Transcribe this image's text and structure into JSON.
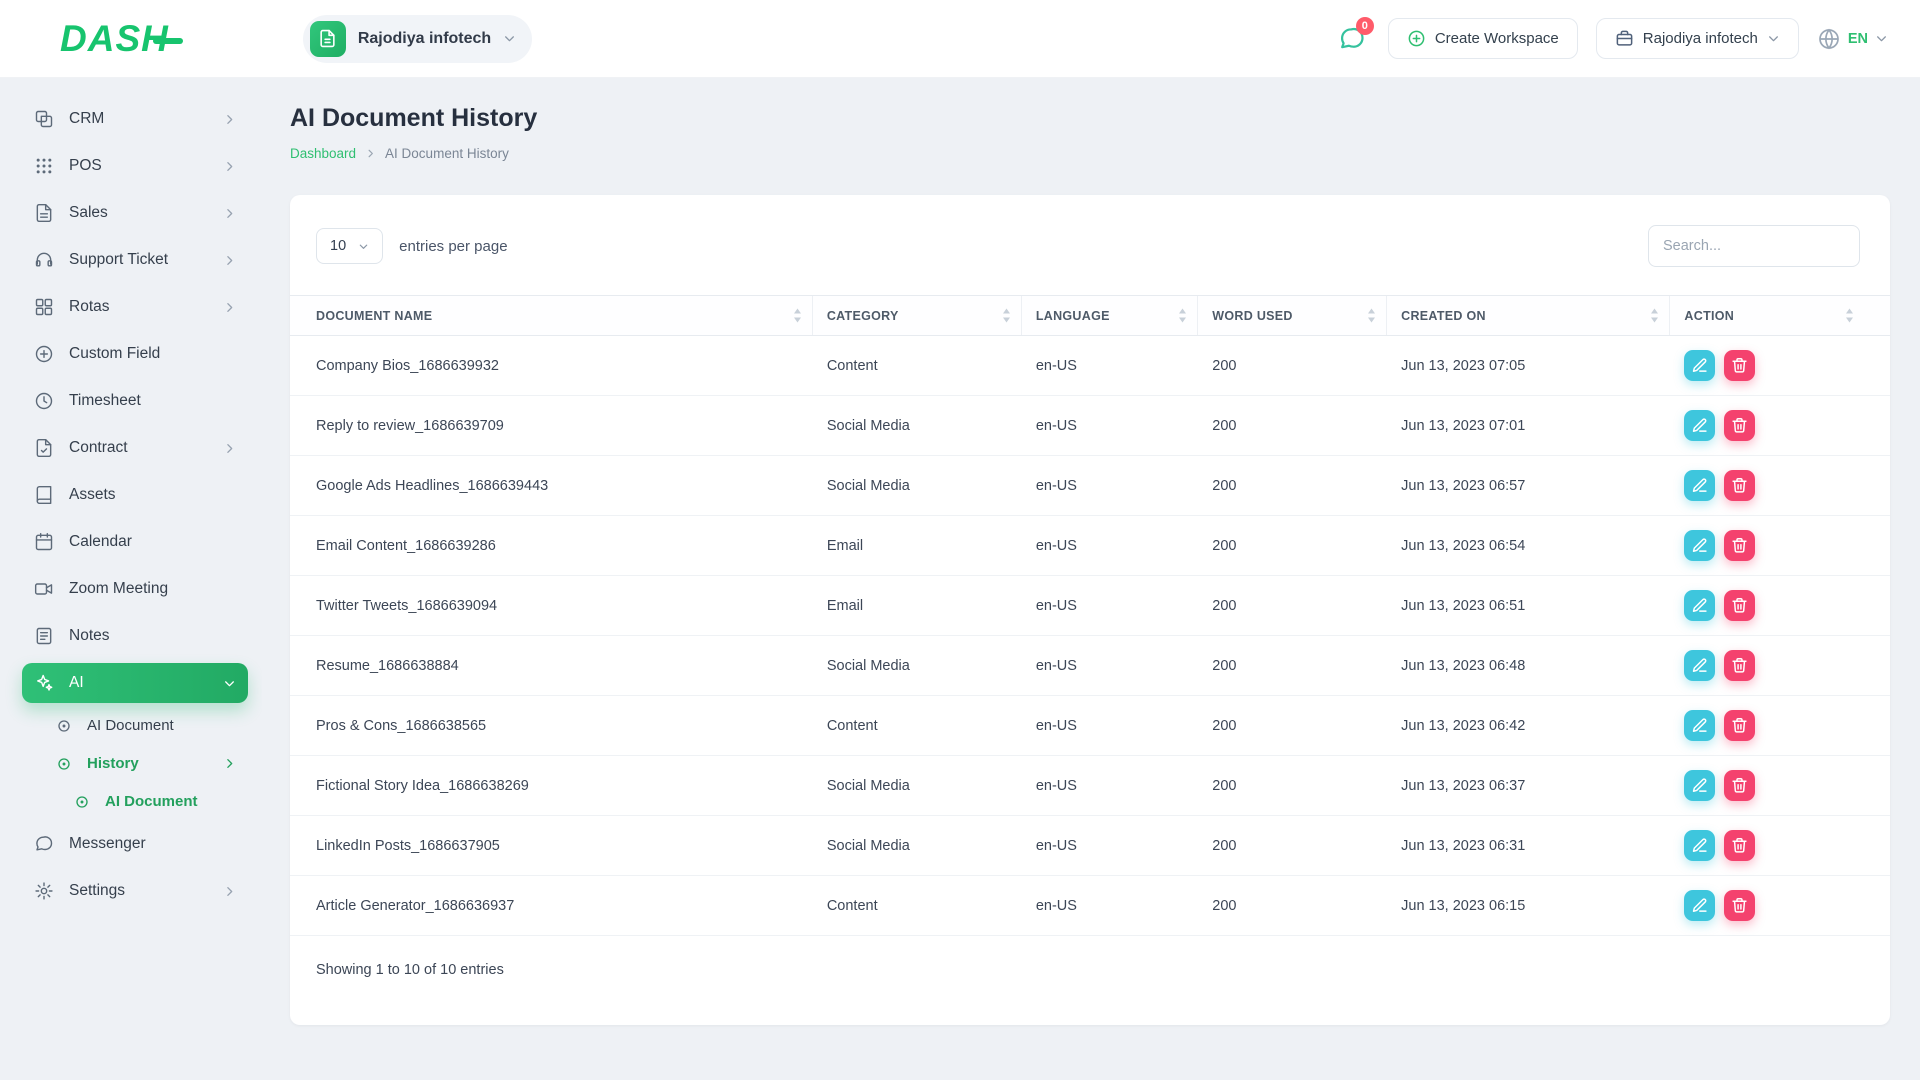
{
  "brand": {
    "logo_text": "DASH"
  },
  "header": {
    "workspace_label": "Rajodiya infotech",
    "messages_badge": "0",
    "create_workspace_label": "Create Workspace",
    "account_label": "Rajodiya infotech",
    "language_label": "EN"
  },
  "sidebar": {
    "items": [
      {
        "id": "crm",
        "label": "CRM",
        "icon": "crm",
        "chevron": "right"
      },
      {
        "id": "pos",
        "label": "POS",
        "icon": "pos",
        "chevron": "right"
      },
      {
        "id": "sales",
        "label": "Sales",
        "icon": "sales",
        "chevron": "right"
      },
      {
        "id": "support-ticket",
        "label": "Support Ticket",
        "icon": "support",
        "chevron": "right"
      },
      {
        "id": "rotas",
        "label": "Rotas",
        "icon": "rotas",
        "chevron": "right"
      },
      {
        "id": "custom-field",
        "label": "Custom Field",
        "icon": "plus-circle"
      },
      {
        "id": "timesheet",
        "label": "Timesheet",
        "icon": "clock"
      },
      {
        "id": "contract",
        "label": "Contract",
        "icon": "contract",
        "chevron": "right"
      },
      {
        "id": "assets",
        "label": "Assets",
        "icon": "book"
      },
      {
        "id": "calendar",
        "label": "Calendar",
        "icon": "calendar"
      },
      {
        "id": "zoom-meeting",
        "label": "Zoom Meeting",
        "icon": "video"
      },
      {
        "id": "notes",
        "label": "Notes",
        "icon": "notes"
      },
      {
        "id": "ai",
        "label": "AI",
        "icon": "ai",
        "chevron": "down",
        "active": true
      },
      {
        "id": "ai-document",
        "label": "AI Document",
        "icon": "bullet",
        "level": 1
      },
      {
        "id": "history",
        "label": "History",
        "icon": "bullet",
        "level": 1,
        "chevron": "right",
        "highlight": true
      },
      {
        "id": "history-ai-document",
        "label": "AI Document",
        "icon": "bullet",
        "level": 2,
        "highlight": true
      },
      {
        "id": "messenger",
        "label": "Messenger",
        "icon": "messenger"
      },
      {
        "id": "settings",
        "label": "Settings",
        "icon": "settings",
        "chevron": "right"
      }
    ]
  },
  "page": {
    "title": "AI Document History",
    "breadcrumb": [
      "Dashboard",
      "AI Document History"
    ]
  },
  "controls": {
    "page_size": "10",
    "entries_label": "entries per page",
    "search_placeholder": "Search..."
  },
  "table": {
    "columns": [
      {
        "key": "name",
        "label": "DOCUMENT NAME"
      },
      {
        "key": "category",
        "label": "CATEGORY"
      },
      {
        "key": "language",
        "label": "LANGUAGE"
      },
      {
        "key": "words",
        "label": "WORD USED"
      },
      {
        "key": "created",
        "label": "CREATED ON"
      },
      {
        "key": "action",
        "label": "ACTION"
      }
    ],
    "rows": [
      {
        "name": "Company Bios_1686639932",
        "category": "Content",
        "language": "en-US",
        "words": "200",
        "created": "Jun 13, 2023 07:05"
      },
      {
        "name": "Reply to review_1686639709",
        "category": "Social Media",
        "language": "en-US",
        "words": "200",
        "created": "Jun 13, 2023 07:01"
      },
      {
        "name": "Google Ads Headlines_1686639443",
        "category": "Social Media",
        "language": "en-US",
        "words": "200",
        "created": "Jun 13, 2023 06:57"
      },
      {
        "name": "Email Content_1686639286",
        "category": "Email",
        "language": "en-US",
        "words": "200",
        "created": "Jun 13, 2023 06:54"
      },
      {
        "name": "Twitter Tweets_1686639094",
        "category": "Email",
        "language": "en-US",
        "words": "200",
        "created": "Jun 13, 2023 06:51"
      },
      {
        "name": "Resume_1686638884",
        "category": "Social Media",
        "language": "en-US",
        "words": "200",
        "created": "Jun 13, 2023 06:48"
      },
      {
        "name": "Pros & Cons_1686638565",
        "category": "Content",
        "language": "en-US",
        "words": "200",
        "created": "Jun 13, 2023 06:42"
      },
      {
        "name": "Fictional Story Idea_1686638269",
        "category": "Social Media",
        "language": "en-US",
        "words": "200",
        "created": "Jun 13, 2023 06:37"
      },
      {
        "name": "LinkedIn Posts_1686637905",
        "category": "Social Media",
        "language": "en-US",
        "words": "200",
        "created": "Jun 13, 2023 06:31"
      },
      {
        "name": "Article Generator_1686636937",
        "category": "Content",
        "language": "en-US",
        "words": "200",
        "created": "Jun 13, 2023 06:15"
      }
    ],
    "footer_text": "Showing 1 to 10 of 10 entries"
  }
}
